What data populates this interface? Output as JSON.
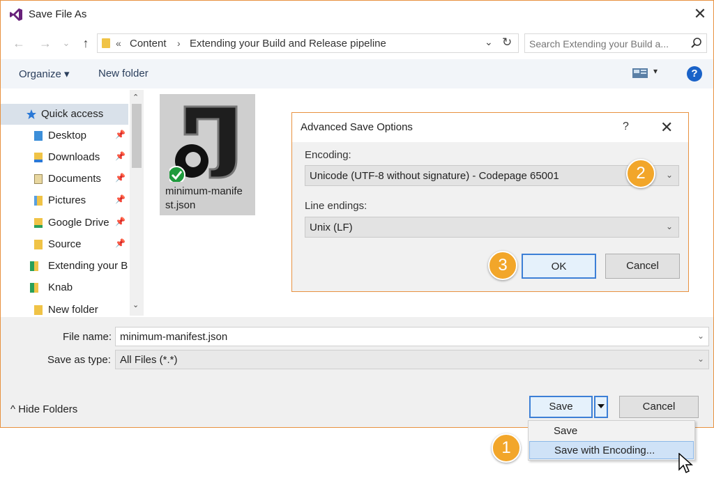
{
  "window": {
    "title": "Save File As",
    "close_glyph": "✕"
  },
  "address": {
    "crumbs": [
      "Content",
      "Extending your Build and Release pipeline"
    ],
    "separator_leading": "«",
    "separator": "›",
    "dropdown_glyph": "⌄",
    "refresh_glyph": "↻"
  },
  "nav_buttons": {
    "back": "←",
    "forward": "→",
    "recent": "⌄",
    "up": "↑"
  },
  "search": {
    "placeholder": "Search Extending your Build a..."
  },
  "command_bar": {
    "organize": "Organize ▾",
    "new_folder": "New folder",
    "view_dropdown": "▾",
    "help": "?"
  },
  "nav_pane": {
    "items": [
      {
        "label": "Quick access",
        "icon": "star-icon",
        "pinned": false
      },
      {
        "label": "Desktop",
        "icon": "folder-icon",
        "pinned": true
      },
      {
        "label": "Downloads",
        "icon": "downloads-folder-icon",
        "pinned": true
      },
      {
        "label": "Documents",
        "icon": "documents-folder-icon",
        "pinned": true
      },
      {
        "label": "Pictures",
        "icon": "pictures-folder-icon",
        "pinned": true
      },
      {
        "label": "Google Drive",
        "icon": "google-drive-folder-icon",
        "pinned": true
      },
      {
        "label": "Source",
        "icon": "folder-icon",
        "pinned": true
      },
      {
        "label": "Extending your B",
        "icon": "synced-folder-icon",
        "pinned": false
      },
      {
        "label": "Knab",
        "icon": "synced-folder-icon",
        "pinned": false
      },
      {
        "label": "New folder",
        "icon": "folder-icon",
        "pinned": false
      }
    ],
    "pin_glyph": "📌",
    "scroll_up": "⌃",
    "scroll_down": "⌄"
  },
  "file": {
    "name_line1": "minimum-manife",
    "name_line2": "st.json"
  },
  "advanced_dialog": {
    "title": "Advanced Save Options",
    "help": "?",
    "close": "✕",
    "encoding_label": "Encoding:",
    "encoding_value": "Unicode (UTF-8 without signature) - Codepage 65001",
    "line_endings_label": "Line endings:",
    "line_endings_value": "Unix (LF)",
    "ok": "OK",
    "cancel": "Cancel",
    "chevron": "⌄"
  },
  "bottom": {
    "file_name_label": "File name:",
    "file_name_value": "minimum-manifest.json",
    "save_type_label": "Save as type:",
    "save_type_value": "All Files (*.*)",
    "hide_folders": "^ Hide Folders",
    "save": "Save",
    "cancel": "Cancel",
    "chevron": "⌄"
  },
  "save_menu": {
    "items": [
      "Save",
      "Save with Encoding..."
    ]
  },
  "callouts": [
    "1",
    "2",
    "3"
  ],
  "colors": {
    "accent_border": "#e8913f",
    "callout": "#f2a62a",
    "focus_blue": "#3c7fd6",
    "help_blue": "#1a62c8"
  }
}
